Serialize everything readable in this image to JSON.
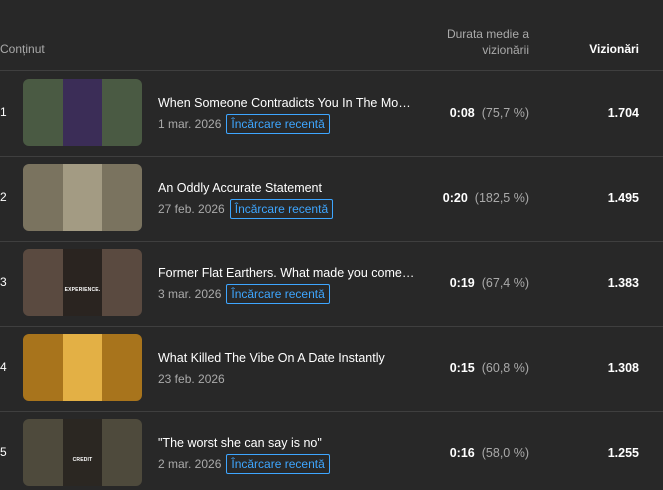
{
  "header": {
    "content_label": "Conținut",
    "duration_label_line1": "Durata medie a",
    "duration_label_line2": "vizionării",
    "views_label": "Vizionări"
  },
  "rows": [
    {
      "rank": "1",
      "title": "When Someone Contradicts You In The Mo…",
      "date": "1 mar. 2026",
      "badge": "Încărcare recentă",
      "avg_duration": "0:08",
      "avg_percent": "(75,7 %)",
      "views": "1.704",
      "thumb_bg": "#4a5a43",
      "thumb_inner": "#3b2d57",
      "thumb_caption": ""
    },
    {
      "rank": "2",
      "title": "An Oddly Accurate Statement",
      "date": "27 feb. 2026",
      "badge": "Încărcare recentă",
      "avg_duration": "0:20",
      "avg_percent": "(182,5 %)",
      "views": "1.495",
      "thumb_bg": "#7a735f",
      "thumb_inner": "#a39b83",
      "thumb_caption": ""
    },
    {
      "rank": "3",
      "title": "Former Flat Earthers. What made you come…",
      "date": "3 mar. 2026",
      "badge": "Încărcare recentă",
      "avg_duration": "0:19",
      "avg_percent": "(67,4 %)",
      "views": "1.383",
      "thumb_bg": "#5a4a40",
      "thumb_inner": "#2a2420",
      "thumb_caption": "EXPERIENCE."
    },
    {
      "rank": "4",
      "title": "What Killed The Vibe On A Date Instantly",
      "date": "23 feb. 2026",
      "badge": "",
      "avg_duration": "0:15",
      "avg_percent": "(60,8 %)",
      "views": "1.308",
      "thumb_bg": "#a8741c",
      "thumb_inner": "#e3b045",
      "thumb_caption": ""
    },
    {
      "rank": "5",
      "title": "\"The worst she can say is no\"",
      "date": "2 mar. 2026",
      "badge": "Încărcare recentă",
      "avg_duration": "0:16",
      "avg_percent": "(58,0 %)",
      "views": "1.255",
      "thumb_bg": "#4e4a3c",
      "thumb_inner": "#2b2722",
      "thumb_caption": "CREDIT"
    }
  ]
}
